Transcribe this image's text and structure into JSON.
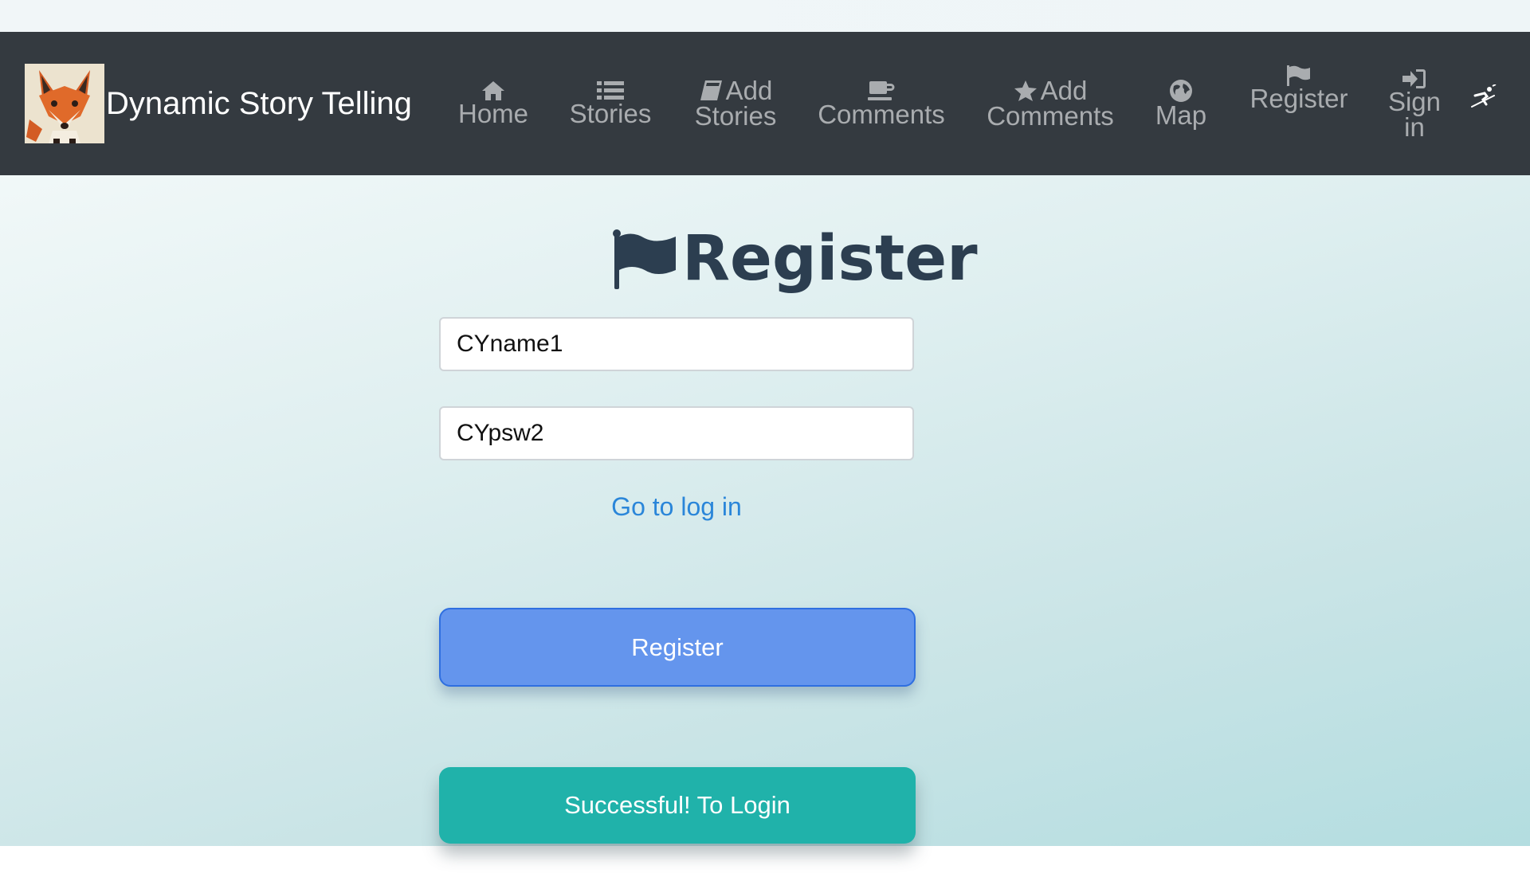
{
  "brand": {
    "title": "Dynamic Story Telling",
    "logo_icon": "fox-logo-icon"
  },
  "nav": {
    "items": [
      {
        "icon": "home-icon",
        "line1": "",
        "line2": "Home"
      },
      {
        "icon": "list-icon",
        "line1": "",
        "line2": "Stories"
      },
      {
        "icon": "book-icon",
        "line1": "Add",
        "line2": "Stories"
      },
      {
        "icon": "coffee-icon",
        "line1": "",
        "line2": "Comments"
      },
      {
        "icon": "star-icon",
        "line1": "Add",
        "line2": "Comments"
      },
      {
        "icon": "globe-icon",
        "line1": "",
        "line2": "Map"
      },
      {
        "icon": "flag-icon",
        "line1": "",
        "line2": "Register"
      },
      {
        "icon": "sign-in-icon",
        "line1": "",
        "line2": "Sign",
        "line3": "in"
      }
    ],
    "corner_icon": "skier-icon"
  },
  "page": {
    "title": "Register",
    "title_icon": "flag-icon",
    "username_value": "CYname1",
    "password_value": "CYpsw2",
    "login_link": "Go to log in",
    "register_button": "Register",
    "success_button": "Successful! To Login"
  },
  "colors": {
    "navbar": "#343a40",
    "nav_text": "#a9acaf",
    "title": "#2c3e50",
    "link": "#2a86d9",
    "register_button": "#6495ed",
    "success_button": "#20b2aa"
  }
}
